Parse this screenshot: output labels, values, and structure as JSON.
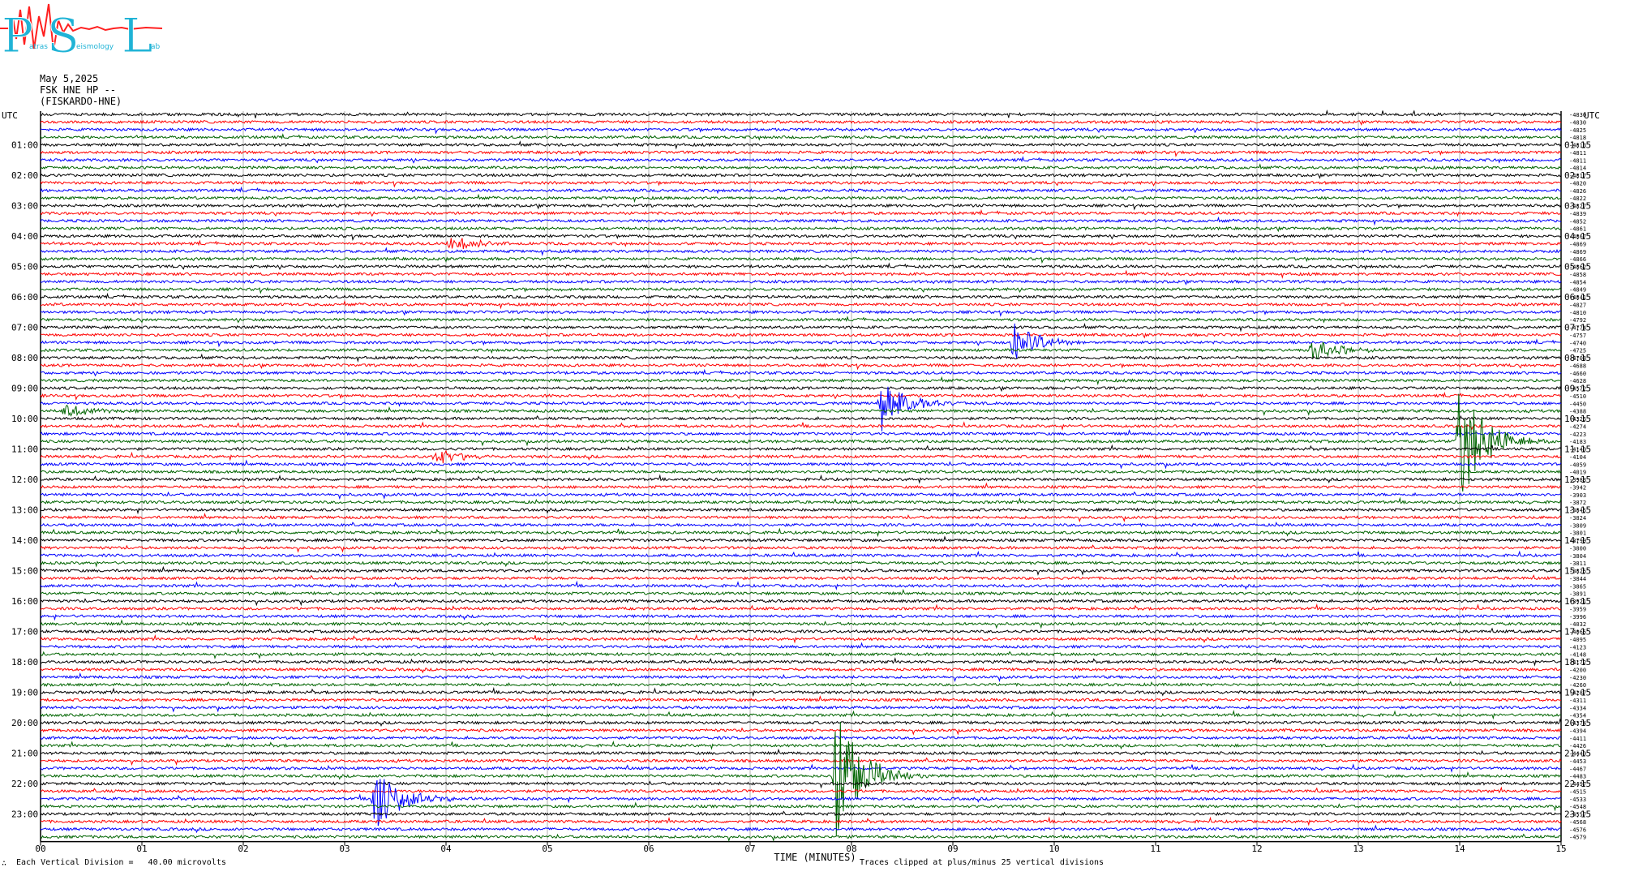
{
  "logo": {
    "letters": [
      "P",
      "S",
      "L"
    ],
    "small_words": [
      "atras",
      "eismology",
      "ab"
    ]
  },
  "header": {
    "date": "May 5,2025",
    "station": "FSK HNE HP --",
    "name": "(FISKARDO-HNE)"
  },
  "footer": {
    "division": "Each Vertical Division =   40.00 microvolts",
    "clip": "Traces clipped at plus/minus 25 vertical divisions",
    "corner": "∴"
  },
  "chart_data": {
    "type": "line",
    "title": "May 5,2025",
    "xlabel": "TIME (MINUTES)",
    "x_ticks": [
      "00",
      "01",
      "02",
      "03",
      "04",
      "05",
      "06",
      "07",
      "08",
      "09",
      "10",
      "11",
      "12",
      "13",
      "14",
      "15"
    ],
    "xlim": [
      0,
      15
    ],
    "left_axis_title": "UTC",
    "right_axis_title": "UTC",
    "left_hour_labels": [
      "01:00",
      "02:00",
      "03:00",
      "04:00",
      "05:00",
      "06:00",
      "07:00",
      "08:00",
      "09:00",
      "10:00",
      "11:00",
      "12:00",
      "13:00",
      "14:00",
      "15:00",
      "16:00",
      "17:00",
      "18:00",
      "19:00",
      "20:00",
      "21:00",
      "22:00",
      "23:00"
    ],
    "right_hour_labels": [
      "01:15",
      "02:15",
      "03:15",
      "04:15",
      "05:15",
      "06:15",
      "07:15",
      "08:15",
      "09:15",
      "10:15",
      "11:15",
      "12:15",
      "13:15",
      "14:15",
      "15:15",
      "16:15",
      "17:15",
      "18:15",
      "19:15",
      "20:15",
      "21:15",
      "22:15",
      "23:15"
    ],
    "trace_colors": [
      "#000000",
      "#ff0000",
      "#0000ff",
      "#006400"
    ],
    "trace_count": 96,
    "right_trace_values": [
      "-4830",
      "-4830",
      "-4825",
      "-4818",
      "-4813",
      "-4811",
      "-4811",
      "-4814",
      "-4817",
      "-4820",
      "-4826",
      "-4822",
      "-4827",
      "-4839",
      "-4852",
      "-4861",
      "-4867",
      "-4869",
      "-4869",
      "-4866",
      "-4862",
      "-4858",
      "-4854",
      "-4849",
      "-4841",
      "-4827",
      "-4810",
      "-4792",
      "-4774",
      "-4757",
      "-4740",
      "-4725",
      "-4708",
      "-4688",
      "-4660",
      "-4628",
      "-4572",
      "-4510",
      "-4450",
      "-4388",
      "-4326",
      "-4274",
      "-4223",
      "-4183",
      "-4140",
      "-4104",
      "-4059",
      "-4019",
      "-3983",
      "-3942",
      "-3903",
      "-3872",
      "-3845",
      "-3824",
      "-3809",
      "-3801",
      "-3799",
      "-3800",
      "-3804",
      "-3811",
      "-3825",
      "-3844",
      "-3865",
      "-3891",
      "-3921",
      "-3959",
      "-3996",
      "-4032",
      "-4065",
      "-4095",
      "-4123",
      "-4148",
      "-4172",
      "-4200",
      "-4230",
      "-4260",
      "-4287",
      "-4311",
      "-4334",
      "-4354",
      "-4374",
      "-4394",
      "-4411",
      "-4426",
      "-4440",
      "-4453",
      "-4467",
      "-4483",
      "-4497",
      "-4515",
      "-4533",
      "-4548",
      "-4557",
      "-4568",
      "-4576",
      "-4579"
    ],
    "events": [
      {
        "trace": 87,
        "minute": 7.85,
        "amp": 1.0,
        "label_color": "#006400"
      },
      {
        "trace": 43,
        "minute": 14.0,
        "amp": 0.85,
        "label_color": "#000000"
      },
      {
        "trace": 38,
        "minute": 8.3,
        "amp": 0.35,
        "label_color": "#0000ff"
      },
      {
        "trace": 30,
        "minute": 9.6,
        "amp": 0.3,
        "label_color": "#0000ff"
      },
      {
        "trace": 90,
        "minute": 3.3,
        "amp": 0.45,
        "label_color": "#0000ff"
      },
      {
        "trace": 31,
        "minute": 12.55,
        "amp": 0.18,
        "label_color": "#006400"
      },
      {
        "trace": 17,
        "minute": 4.05,
        "amp": 0.12,
        "label_color": "#ff0000"
      },
      {
        "trace": 45,
        "minute": 3.9,
        "amp": 0.12,
        "label_color": "#ff0000"
      },
      {
        "trace": 39,
        "minute": 0.25,
        "amp": 0.1,
        "label_color": "#006400"
      }
    ]
  }
}
